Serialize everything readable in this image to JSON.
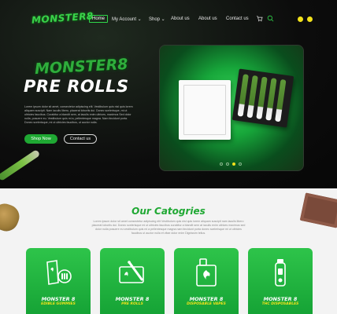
{
  "header": {
    "logo_text": "MONSTER8",
    "nav": [
      {
        "label": "Home"
      },
      {
        "label": "My Account ⌄"
      },
      {
        "label": "Shop ⌄"
      },
      {
        "label": "About us"
      },
      {
        "label": "About us"
      },
      {
        "label": "Contact us"
      }
    ],
    "icons": [
      "cart-icon",
      "search-icon"
    ]
  },
  "hero": {
    "brand": "MONSTER8",
    "title": "PRE ROLLS",
    "description": "Lorem ipsum dolor sit amet, consectetur adipiscing elit. Vestibulum quis nisl quis lorem aliquam suscipit. Nam iaculis libero, placerat lobortis dui. Donec scelerisque, mi ut ultricies faucibus. Curabitur a blandit sem, at iaculis enim ultrices, maximus Sed dolor nulla, posuere eu. Vestibulum quis mi a, pellentesque magna. Nam tincidunt porta. Donec scelerisque, mi ut ultricies faucibus, ut auctor nulla.",
    "shop_button": "Shop Now",
    "contact_button": "Contact us",
    "slider_dots": 4,
    "slider_active": 2
  },
  "categories": {
    "title": "Our Catogries",
    "description": "Lorem ipsum dolor sit amet consectetur adipiscing elit Vestibulum quis nisl quis lorem aliquam suscipit nam iaculis libero placerat lobortis dui. Donec scelerisque mi ut ultricies faucibus curabitur a blandit sem at iaculis enim ultrices maximus sed dolor nulla posuere eu vestibulum quis mi a pellentesque magna nam tincidunt porta donec scelerisque mi ut ultricies faucibus ut auctor nulla et vitae dolor enim Dignissim tellus.",
    "cards": [
      {
        "title": "MONSTER 8",
        "subtitle": "EDIBLE GUMMIES",
        "icon": "gummies-icon"
      },
      {
        "title": "MONSTER 8",
        "subtitle": "PRE ROLLS",
        "icon": "pre-roll-icon"
      },
      {
        "title": "MONSTER 8",
        "subtitle": "DISPOSABLE VAPES",
        "icon": "vape-box-icon"
      },
      {
        "title": "MONSTER 8",
        "subtitle": "THC DISPOSABLES",
        "icon": "thc-pen-icon"
      }
    ]
  },
  "colors": {
    "accent_green": "#1fa833",
    "accent_yellow": "#f2e21b",
    "hero_bg": "#0c0c0c"
  }
}
